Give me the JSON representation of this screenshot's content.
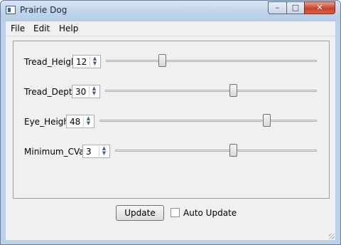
{
  "window": {
    "title": "Prairie Dog",
    "ghost_title": "Prairie Dog",
    "controls": {
      "minimize": "–",
      "maximize": "□",
      "close": "✕"
    }
  },
  "menu": [
    "File",
    "Edit",
    "Help"
  ],
  "sliders": [
    {
      "label": "Tread_Height",
      "value": "12",
      "level": 0.26
    },
    {
      "label": "Tread_Depth",
      "value": "30",
      "level": 0.61
    },
    {
      "label": "Eye_Height",
      "value": "48",
      "level": 0.78
    },
    {
      "label": "Minimum_CValue",
      "value": "3",
      "level": 0.59
    }
  ],
  "spin_arrows": {
    "up": "▲",
    "down": "▼"
  },
  "footer": {
    "update_label": "Update",
    "auto_update_label": "Auto Update",
    "auto_update_checked": false
  }
}
